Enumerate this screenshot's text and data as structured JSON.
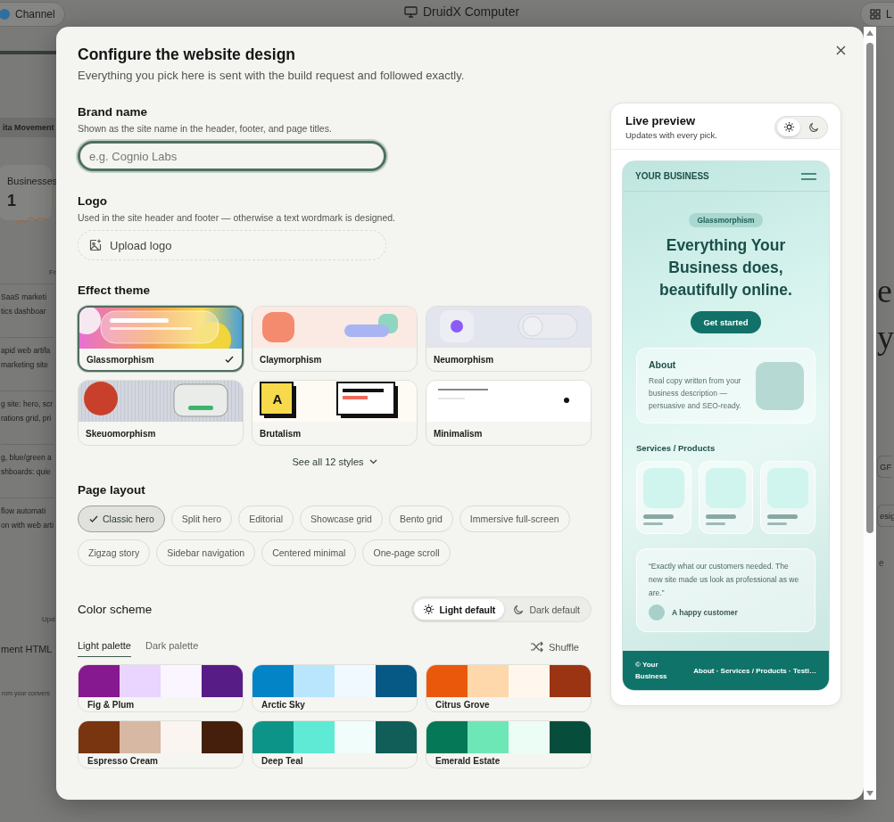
{
  "backdrop": {
    "channel_button": "Channel",
    "app_title": "DruidX Computer",
    "corner_button": "L",
    "banner": "ita Movement",
    "stat_label": "Businesses",
    "stat_value": "1",
    "caption": "Fr",
    "list_items": [
      [
        "SaaS marketi",
        "tics dashboar"
      ],
      [
        "apid web artifa",
        "marketing site"
      ],
      [
        "g site: hero, scr",
        "rations grid, pri"
      ],
      [
        "g, blue/green a",
        "shboards: quie"
      ],
      [
        "flow automati",
        "on with web arti"
      ]
    ],
    "update_note": "Upd",
    "doc_title": "ment HTML",
    "footer_note": "rom your convers",
    "hero_letters": [
      "e",
      "y"
    ],
    "right_chip": "GF",
    "right_button": "esig",
    "right_note": "e"
  },
  "dialog": {
    "title": "Configure the website design",
    "subtitle": "Everything you pick here is sent with the build request and followed exactly.",
    "brand": {
      "label": "Brand name",
      "hint": "Shown as the site name in the header, footer, and page titles.",
      "placeholder": "e.g. Cognio Labs"
    },
    "logo": {
      "label": "Logo",
      "hint": "Used in the site header and footer — otherwise a text wordmark is designed.",
      "button": "Upload logo"
    },
    "theme": {
      "label": "Effect theme",
      "see_all": "See all 12 styles",
      "cards": [
        {
          "name": "Glassmorphism",
          "kind": "glass",
          "selected": true
        },
        {
          "name": "Claymorphism",
          "kind": "clay",
          "selected": false
        },
        {
          "name": "Neumorphism",
          "kind": "neu",
          "selected": false
        },
        {
          "name": "Skeuomorphism",
          "kind": "skeuo",
          "selected": false
        },
        {
          "name": "Brutalism",
          "kind": "brutal",
          "selected": false,
          "tile_letter": "A"
        },
        {
          "name": "Minimalism",
          "kind": "minimal",
          "selected": false
        }
      ]
    },
    "layout": {
      "label": "Page layout",
      "chips": [
        {
          "label": "Classic hero",
          "selected": true
        },
        {
          "label": "Split hero",
          "selected": false
        },
        {
          "label": "Editorial",
          "selected": false
        },
        {
          "label": "Showcase grid",
          "selected": false
        },
        {
          "label": "Bento grid",
          "selected": false
        },
        {
          "label": "Immersive full-screen",
          "selected": false
        },
        {
          "label": "Zigzag story",
          "selected": false
        },
        {
          "label": "Sidebar navigation",
          "selected": false
        },
        {
          "label": "Centered minimal",
          "selected": false
        },
        {
          "label": "One-page scroll",
          "selected": false
        }
      ]
    },
    "colors": {
      "label": "Color scheme",
      "modes": [
        {
          "label": "Light default",
          "kind": "light",
          "selected": true
        },
        {
          "label": "Dark default",
          "kind": "dark",
          "selected": false
        }
      ],
      "tabs": [
        {
          "label": "Light palette",
          "selected": true
        },
        {
          "label": "Dark palette",
          "selected": false
        }
      ],
      "shuffle": "Shuffle",
      "palettes": [
        {
          "name": "Fig & Plum",
          "swatches": [
            {
              "color": "#86198f"
            },
            {
              "color": "#e9d5ff"
            },
            {
              "color": "#faf5ff"
            },
            {
              "color": "#581c87"
            }
          ]
        },
        {
          "name": "Arctic Sky",
          "swatches": [
            {
              "color": "#0284c7"
            },
            {
              "color": "#bae6fd"
            },
            {
              "color": "#f0f9ff"
            },
            {
              "color": "#075985"
            }
          ]
        },
        {
          "name": "Citrus Grove",
          "swatches": [
            {
              "color": "#ea580c"
            },
            {
              "color": "#fed7aa"
            },
            {
              "color": "#fff7ed"
            },
            {
              "color": "#9a3412"
            }
          ]
        },
        {
          "name": "Espresso Cream",
          "swatches": [
            {
              "color": "#78350f"
            },
            {
              "color": "#d6b8a3"
            },
            {
              "color": "#faf5f0"
            },
            {
              "color": "#451f0b"
            }
          ]
        },
        {
          "name": "Deep Teal",
          "swatches": [
            {
              "color": "#0d9488"
            },
            {
              "color": "#5eead4"
            },
            {
              "color": "#f0fdfa"
            },
            {
              "color": "#115e59"
            }
          ]
        },
        {
          "name": "Emerald Estate",
          "swatches": [
            {
              "color": "#047857"
            },
            {
              "color": "#6ee7b7"
            },
            {
              "color": "#ecfdf5"
            },
            {
              "color": "#064e3b"
            }
          ]
        }
      ]
    }
  },
  "preview": {
    "title": "Live preview",
    "subtitle": "Updates with every pick.",
    "modes": [
      {
        "kind": "light",
        "selected": true
      },
      {
        "kind": "dark",
        "selected": false
      }
    ],
    "site": {
      "brand": "YOUR BUSINESS",
      "badge": "Glassmorphism",
      "headline": "Everything Your Business does, beautifully online.",
      "cta": "Get started",
      "about_title": "About",
      "about_text": "Real copy written from your business description — persuasive and SEO-ready.",
      "services_title": "Services / Products",
      "quote": "“Exactly what our customers needed. The new site made us look as professional as we are.”",
      "author": "A happy customer",
      "footer_brand": "© Your Business",
      "footer_links": "About · Services / Products · Testi…"
    }
  }
}
